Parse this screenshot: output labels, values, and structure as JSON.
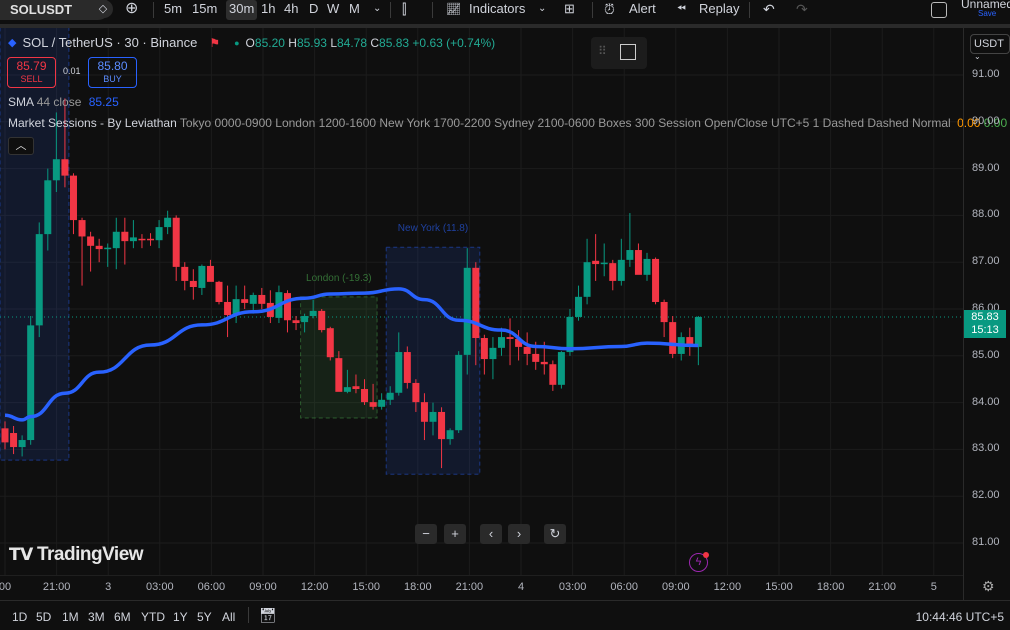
{
  "toolbar": {
    "symbol": "SOLUSDT",
    "timeframes": [
      "5m",
      "15m",
      "30m",
      "1h",
      "4h",
      "D",
      "W",
      "M"
    ],
    "active_timeframe": "30m",
    "indicators_label": "Indicators",
    "alert_label": "Alert",
    "replay_label": "Replay",
    "layout_name": "Unnamed",
    "save_label": "Save"
  },
  "legend": {
    "title": "SOL / TetherUS · 30 · Binance",
    "o_label": "O",
    "o": "85.20",
    "h_label": "H",
    "h": "85.93",
    "l_label": "L",
    "l": "84.78",
    "c_label": "C",
    "c": "85.83",
    "change": "+0.63 (+0.74%)",
    "sell_price": "85.79",
    "sell_label": "SELL",
    "spread": "0.01",
    "buy_price": "85.80",
    "buy_label": "BUY",
    "sma_name": "SMA",
    "sma_params": "44 close",
    "sma_value": "85.25",
    "sessions_name": "Market Sessions - By Leviathan",
    "sessions_params": "Tokyo 0000-0900 London 1200-1600 New York 1700-2200 Sydney 2100-0600 Boxes 300 Session Open/Close UTC+5 1 Dashed Dashed Normal",
    "sessions_v1": "0.00",
    "sessions_v2": "0.00",
    "sessions_more": "..."
  },
  "currency": "USDT",
  "last_price": "85.83",
  "countdown": "15:13",
  "brand": "TradingView",
  "time_zone_clock": "10:44:46 UTC+5",
  "ranges": [
    "1D",
    "5D",
    "1M",
    "3M",
    "6M",
    "YTD",
    "1Y",
    "5Y",
    "All"
  ],
  "colors": {
    "up": "#089981",
    "down": "#f23645",
    "sma": "#2962ff",
    "bg": "#0f0f0f"
  },
  "chart_data": {
    "type": "candlestick",
    "price_ticks": [
      "91.00",
      "90.00",
      "89.00",
      "88.00",
      "87.00",
      "86.00",
      "85.00",
      "84.00",
      "83.00",
      "82.00",
      "81.00"
    ],
    "time_ticks": [
      "00",
      "21:00",
      "3",
      "03:00",
      "06:00",
      "09:00",
      "12:00",
      "15:00",
      "18:00",
      "21:00",
      "4",
      "03:00",
      "06:00",
      "09:00",
      "12:00",
      "15:00",
      "18:00",
      "21:00",
      "5"
    ],
    "ylim": [
      80.7,
      92.1
    ],
    "ohlc": [
      [
        83.45,
        83.6,
        83.0,
        83.15
      ],
      [
        83.35,
        83.5,
        82.9,
        83.05
      ],
      [
        83.05,
        83.3,
        82.85,
        83.2
      ],
      [
        83.2,
        85.85,
        83.1,
        85.65
      ],
      [
        85.65,
        87.85,
        85.4,
        87.6
      ],
      [
        87.6,
        89.0,
        87.25,
        88.75
      ],
      [
        88.75,
        90.2,
        88.5,
        89.2
      ],
      [
        89.2,
        90.5,
        88.6,
        88.85
      ],
      [
        88.85,
        88.9,
        87.6,
        87.9
      ],
      [
        87.9,
        87.95,
        86.5,
        87.55
      ],
      [
        87.55,
        87.65,
        86.8,
        87.35
      ],
      [
        87.35,
        87.5,
        87.0,
        87.28
      ],
      [
        87.3,
        87.4,
        86.9,
        87.31
      ],
      [
        87.3,
        87.95,
        86.85,
        87.65
      ],
      [
        87.65,
        87.95,
        86.95,
        87.45
      ],
      [
        87.45,
        87.9,
        87.3,
        87.53
      ],
      [
        87.5,
        87.6,
        87.3,
        87.48
      ],
      [
        87.5,
        87.62,
        87.35,
        87.47
      ],
      [
        87.47,
        87.9,
        87.3,
        87.75
      ],
      [
        87.75,
        88.1,
        87.6,
        87.95
      ],
      [
        87.95,
        88.0,
        86.6,
        86.9
      ],
      [
        86.9,
        87.0,
        86.4,
        86.6
      ],
      [
        86.6,
        86.85,
        86.2,
        86.47
      ],
      [
        86.45,
        86.95,
        86.3,
        86.92
      ],
      [
        86.92,
        87.05,
        86.6,
        86.58
      ],
      [
        86.58,
        86.6,
        86.1,
        86.15
      ],
      [
        86.15,
        86.5,
        85.4,
        85.87
      ],
      [
        85.87,
        86.5,
        85.7,
        86.21
      ],
      [
        86.21,
        86.5,
        86.0,
        86.13
      ],
      [
        86.11,
        86.35,
        85.9,
        86.3
      ],
      [
        86.3,
        86.45,
        86.0,
        86.11
      ],
      [
        86.13,
        86.4,
        85.7,
        85.83
      ],
      [
        85.81,
        86.5,
        85.7,
        86.36
      ],
      [
        86.34,
        86.4,
        85.5,
        85.76
      ],
      [
        85.76,
        85.85,
        85.55,
        85.7
      ],
      [
        85.72,
        85.9,
        85.5,
        85.85
      ],
      [
        85.85,
        86.2,
        85.8,
        85.96
      ],
      [
        85.96,
        86.0,
        85.5,
        85.55
      ],
      [
        85.59,
        85.62,
        84.9,
        84.97
      ],
      [
        84.95,
        85.1,
        84.25,
        84.23
      ],
      [
        84.23,
        84.7,
        84.2,
        84.33
      ],
      [
        84.35,
        84.6,
        84.2,
        84.29
      ],
      [
        84.29,
        84.5,
        83.95,
        84.01
      ],
      [
        84.01,
        84.4,
        83.85,
        83.91
      ],
      [
        83.91,
        84.2,
        83.85,
        84.06
      ],
      [
        84.06,
        84.35,
        83.95,
        84.21
      ],
      [
        84.21,
        85.5,
        84.15,
        85.08
      ],
      [
        85.08,
        85.2,
        84.3,
        84.42
      ],
      [
        84.42,
        84.5,
        83.8,
        84.01
      ],
      [
        84.01,
        84.2,
        83.2,
        83.59
      ],
      [
        83.59,
        84.0,
        83.3,
        83.8
      ],
      [
        83.8,
        83.9,
        82.6,
        83.22
      ],
      [
        83.22,
        83.45,
        83.1,
        83.41
      ],
      [
        83.41,
        85.1,
        83.35,
        85.02
      ],
      [
        85.02,
        87.3,
        84.6,
        86.88
      ],
      [
        86.88,
        87.0,
        84.8,
        85.38
      ],
      [
        85.38,
        85.45,
        84.6,
        84.93
      ],
      [
        84.93,
        85.4,
        84.5,
        85.17
      ],
      [
        85.17,
        85.6,
        85.0,
        85.4
      ],
      [
        85.4,
        85.8,
        84.8,
        85.36
      ],
      [
        85.36,
        85.55,
        84.9,
        85.19
      ],
      [
        85.19,
        85.5,
        84.8,
        85.04
      ],
      [
        85.04,
        85.3,
        84.7,
        84.87
      ],
      [
        84.87,
        85.3,
        84.6,
        84.82
      ],
      [
        84.82,
        84.9,
        84.25,
        84.38
      ],
      [
        84.38,
        85.1,
        84.3,
        85.08
      ],
      [
        85.08,
        86.0,
        85.0,
        85.83
      ],
      [
        85.83,
        86.5,
        85.75,
        86.26
      ],
      [
        86.26,
        87.5,
        86.1,
        87.0
      ],
      [
        87.03,
        87.6,
        86.6,
        86.96
      ],
      [
        86.98,
        87.4,
        86.7,
        86.99
      ],
      [
        86.98,
        87.05,
        86.4,
        86.6
      ],
      [
        86.6,
        87.5,
        86.5,
        87.05
      ],
      [
        87.05,
        88.05,
        86.9,
        87.26
      ],
      [
        87.26,
        87.4,
        86.8,
        86.73
      ],
      [
        86.73,
        87.2,
        86.6,
        87.07
      ],
      [
        87.07,
        87.1,
        86.1,
        86.15
      ],
      [
        86.15,
        86.2,
        85.4,
        85.72
      ],
      [
        85.72,
        85.85,
        84.95,
        85.04
      ],
      [
        85.04,
        85.5,
        84.9,
        85.4
      ],
      [
        85.4,
        85.6,
        85.0,
        85.19
      ],
      [
        85.19,
        85.85,
        84.8,
        85.83
      ]
    ],
    "sma": [
      [
        0,
        83.73
      ],
      [
        2,
        83.63
      ],
      [
        3,
        83.7
      ],
      [
        7,
        84.2
      ],
      [
        11,
        84.65
      ],
      [
        17,
        85.23
      ],
      [
        23,
        85.66
      ],
      [
        29,
        85.94
      ],
      [
        35,
        86.23
      ],
      [
        38,
        86.32
      ],
      [
        42,
        86.34
      ],
      [
        46,
        86.43
      ],
      [
        49,
        86.2
      ],
      [
        53,
        85.76
      ],
      [
        58,
        85.55
      ],
      [
        62,
        85.2
      ],
      [
        66,
        85.15
      ],
      [
        72,
        85.2
      ],
      [
        75,
        85.27
      ],
      [
        81,
        85.22
      ]
    ],
    "sessions": [
      {
        "label": "",
        "from": -1,
        "to": 7,
        "top": 92.5,
        "bottom": 82.77,
        "color": "#2962ff"
      },
      {
        "label": "London  (-19.3)",
        "from": 35,
        "to": 43,
        "top": 86.26,
        "bottom": 83.67,
        "color": "#4caf50"
      },
      {
        "label": "New York  (11.8)",
        "from": 45,
        "to": 55,
        "top": 87.32,
        "bottom": 82.47,
        "color": "#2962ff"
      }
    ]
  }
}
